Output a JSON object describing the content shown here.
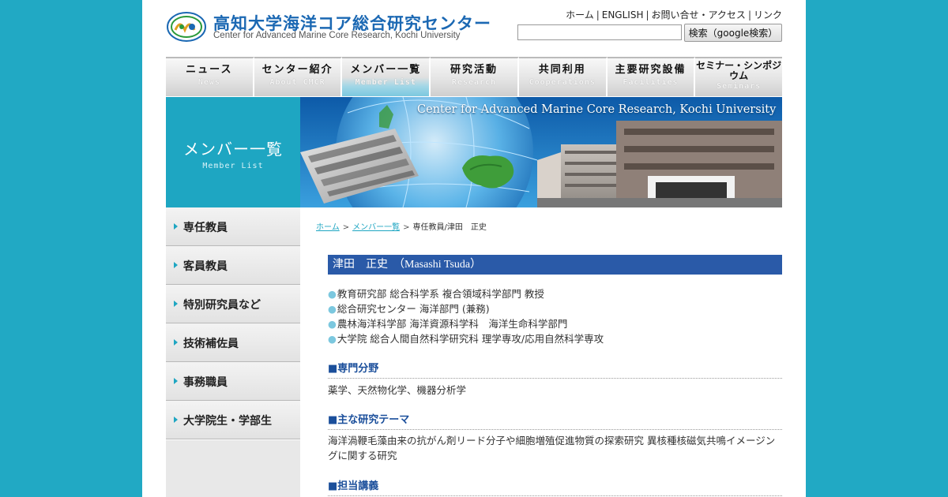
{
  "header": {
    "logo_title": "高知大学海洋コア総合研究センター",
    "logo_subtitle": "Center for Advanced Marine Core Research, Kochi University",
    "top_links": [
      "ホーム",
      "ENGLISH",
      "お問い合せ・アクセス",
      "リンク"
    ],
    "search_placeholder": "",
    "search_button": "検索（google検索）"
  },
  "nav": [
    {
      "jp": "ニュース",
      "en": "News"
    },
    {
      "jp": "センター紹介",
      "en": "About CMCR"
    },
    {
      "jp": "メンバー一覧",
      "en": "Member List"
    },
    {
      "jp": "研究活動",
      "en": "Research"
    },
    {
      "jp": "共同利用",
      "en": "Cooperations"
    },
    {
      "jp": "主要研究設備",
      "en": "Facilities"
    },
    {
      "jp": "セミナー・シンポジウム",
      "en": "Seminars"
    }
  ],
  "nav_active_index": 2,
  "banner": {
    "title": "メンバー一覧",
    "subtitle": "Member List",
    "caption": "Center for Advanced Marine Core Research, Kochi University"
  },
  "sidebar": {
    "items": [
      "専任教員",
      "客員教員",
      "特別研究員など",
      "技術補佐員",
      "事務職員",
      "大学院生・学部生"
    ]
  },
  "breadcrumb": {
    "home": "ホーム",
    "members": "メンバー一覧",
    "current": "専任教員/津田　正史"
  },
  "person": {
    "name": "津田　正史　（Masashi Tsuda）",
    "positions": [
      "教育研究部 総合科学系 複合領域科学部門 教授",
      "総合研究センター 海洋部門 (兼務)",
      "農林海洋科学部 海洋資源科学科　海洋生命科学部門",
      "大学院 総合人間自然科学研究科 理学専攻/応用自然科学専攻"
    ],
    "field_heading": "■専門分野",
    "field_text": "薬学、天然物化学、機器分析学",
    "theme_heading": "■主な研究テーマ",
    "theme_text": "海洋渦鞭毛藻由来の抗がん剤リード分子や細胞増殖促進物質の探索研究 異核種核磁気共鳴イメージングに関する研究",
    "lecture_heading": "■担当講義"
  },
  "colors": {
    "background": "#21a9c4",
    "accent": "#1ea6c2",
    "name_bar": "#2a5aa8",
    "heading": "#1b4f9b"
  }
}
